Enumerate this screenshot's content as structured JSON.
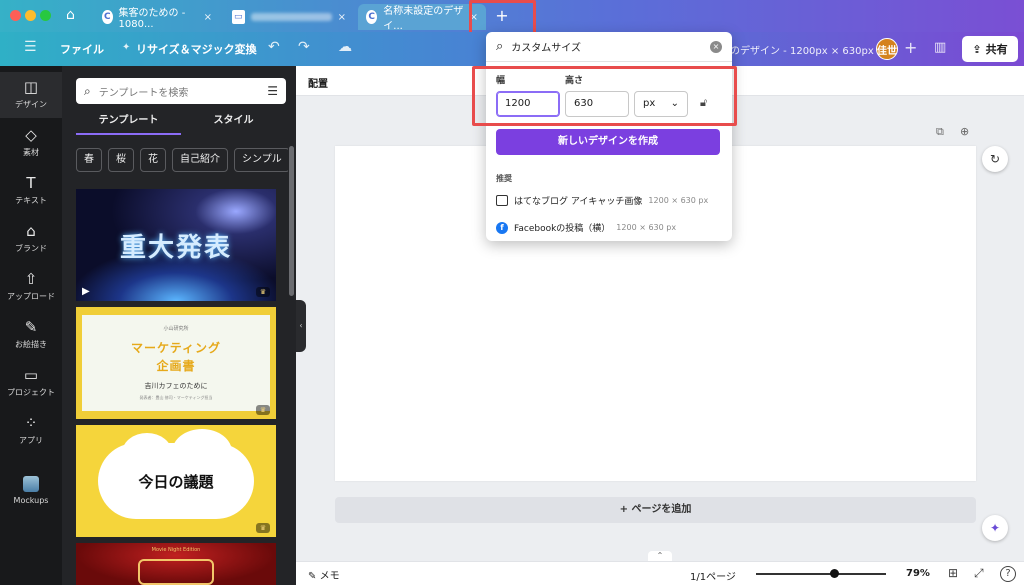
{
  "browser": {
    "tabs": [
      {
        "label": "集客のための - 1080...",
        "close": "×"
      },
      {
        "label": "",
        "close": "×"
      },
      {
        "label": "名称未設定のデザイ...",
        "close": "×"
      }
    ],
    "new_tab": "+"
  },
  "toolbar": {
    "menu_icon": "☰",
    "file_label": "ファイル",
    "resize_label": "リサイズ＆マジック変換",
    "doc_title": "のデザイン - 1200px × 630px",
    "avatar_text": "佳世",
    "add": "+",
    "share_label": "共有"
  },
  "rail": {
    "items": [
      {
        "label": "デザイン",
        "icon": "layout-icon"
      },
      {
        "label": "素材",
        "icon": "elements-icon"
      },
      {
        "label": "テキスト",
        "icon": "text-icon"
      },
      {
        "label": "ブランド",
        "icon": "brand-icon"
      },
      {
        "label": "アップロード",
        "icon": "upload-icon"
      },
      {
        "label": "お絵描き",
        "icon": "draw-icon"
      },
      {
        "label": "プロジェクト",
        "icon": "folder-icon"
      },
      {
        "label": "アプリ",
        "icon": "apps-icon"
      },
      {
        "label": "Mockups",
        "icon": "mockups-icon"
      }
    ]
  },
  "panel": {
    "search_placeholder": "テンプレートを検索",
    "tabs": [
      "テンプレート",
      "スタイル"
    ],
    "chips": [
      "春",
      "桜",
      "花",
      "自己紹介",
      "シンプル"
    ],
    "templates": {
      "t1_title": "重大発表",
      "t2_small": "小山研究所",
      "t2_big1": "マーケティング",
      "t2_big2": "企画書",
      "t2_sub": "吉川カフェのために",
      "t2_tiny": "発表者：豊山 修司・マーケティング担当",
      "t3_text": "今日の議題",
      "t4_small": "Movie Night Edition"
    }
  },
  "canvas": {
    "top_label": "配置",
    "add_page": "+ ページを追加"
  },
  "bottom": {
    "memo": "メモ",
    "page": "1/1ページ",
    "zoom_percent": 79,
    "zoom_label": "79%",
    "help": "?"
  },
  "dropdown": {
    "search_value": "カスタムサイズ",
    "width_label": "幅",
    "height_label": "高さ",
    "width_value": "1200",
    "height_value": "630",
    "unit": "px",
    "create_label": "新しいデザインを作成",
    "recommended_label": "推奨",
    "recommendations": [
      {
        "name": "はてなブログ アイキャッチ画像",
        "size": "1200 × 630 px",
        "icon": "image-icon"
      },
      {
        "name": "Facebookの投稿（横）",
        "size": "1200 × 630 px",
        "icon": "facebook-icon"
      }
    ]
  },
  "colors": {
    "highlight": "#e84c4c",
    "create_button": "#7b3fe0",
    "accent": "#8b6cf6"
  }
}
